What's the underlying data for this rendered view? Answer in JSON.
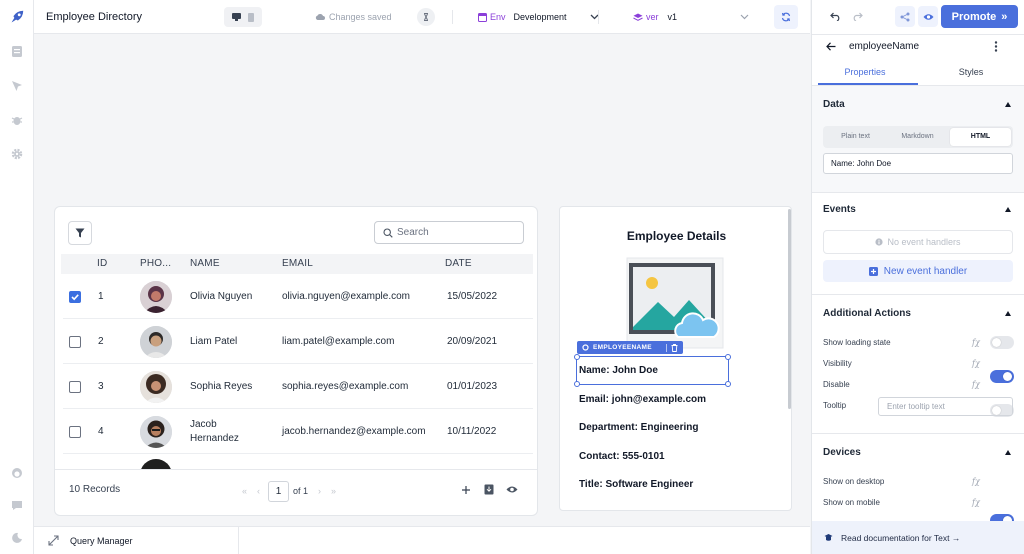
{
  "topbar": {
    "app_title": "Employee Directory",
    "status": "Changes saved",
    "env_label": "Env",
    "env_value": "Development",
    "ver_label": "ver",
    "ver_value": "v1",
    "promote_label": "Promote"
  },
  "table": {
    "search_placeholder": "Search",
    "columns": [
      "ID",
      "PHO...",
      "NAME",
      "EMAIL",
      "DATE"
    ],
    "rows": [
      {
        "id": "1",
        "name": "Olivia Nguyen",
        "email": "olivia.nguyen@example.com",
        "date": "15/05/2022",
        "checked": true
      },
      {
        "id": "2",
        "name": "Liam Patel",
        "email": "liam.patel@example.com",
        "date": "20/09/2021",
        "checked": false
      },
      {
        "id": "3",
        "name": "Sophia Reyes",
        "email": "sophia.reyes@example.com",
        "date": "01/01/2023",
        "checked": false
      },
      {
        "id": "4",
        "name": "Jacob Hernandez",
        "email": "jacob.hernandez@example.com",
        "date": "10/11/2022",
        "checked": false
      }
    ],
    "records": "10 Records",
    "page": "1",
    "page_of": "of 1"
  },
  "details": {
    "title": "Employee Details",
    "component_tag": "EMPLOYEENAME",
    "name": "Name: John Doe",
    "email": "Email: john@example.com",
    "department": "Department: Engineering",
    "contact": "Contact: 555-0101",
    "title_line": "Title: Software Engineer"
  },
  "inspector": {
    "component_name": "employeeName",
    "tabs": [
      "Properties",
      "Styles"
    ],
    "active_tab": "Properties",
    "data": {
      "heading": "Data",
      "modes": [
        "Plain text",
        "Markdown",
        "HTML"
      ],
      "active_mode": "HTML",
      "value": "Name: John Doe"
    },
    "events": {
      "heading": "Events",
      "empty": "No event handlers",
      "new_label": "New event handler"
    },
    "additional": {
      "heading": "Additional Actions",
      "loading_label": "Show loading state",
      "loading": false,
      "visibility_label": "Visibility",
      "visibility": true,
      "disable_label": "Disable",
      "disable": false,
      "tooltip_label": "Tooltip",
      "tooltip_placeholder": "Enter tooltip text"
    },
    "devices": {
      "heading": "Devices",
      "desktop_label": "Show on desktop",
      "desktop": true,
      "mobile_label": "Show on mobile",
      "mobile": false
    },
    "docs_link": "Read documentation for Text →",
    "fx": "fχ"
  },
  "bottombar": {
    "query_manager": "Query Manager"
  },
  "colors": {
    "accent": "#4a6fdc",
    "env_purple": "#8b3fd9",
    "checkbox_blue": "#3b6fe0"
  }
}
